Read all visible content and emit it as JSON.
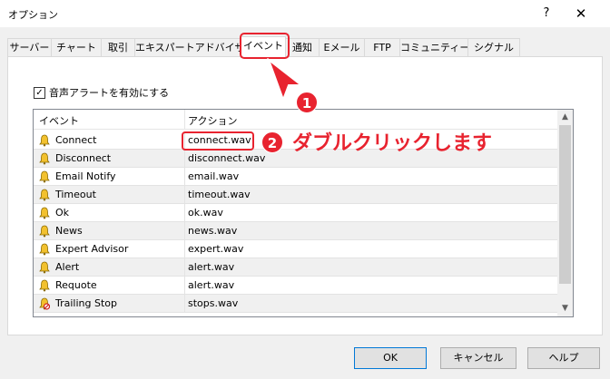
{
  "window": {
    "title": "オプション",
    "help_label": "?",
    "close_label": "✕"
  },
  "tabs": [
    {
      "label": "サーバー"
    },
    {
      "label": "チャート"
    },
    {
      "label": "取引"
    },
    {
      "label": "エキスパートアドバイザ"
    },
    {
      "label": "イベント"
    },
    {
      "label": "通知"
    },
    {
      "label": "Eメール"
    },
    {
      "label": "FTP"
    },
    {
      "label": "コミュニティー"
    },
    {
      "label": "シグナル"
    }
  ],
  "active_tab": "イベント",
  "sound_alert": {
    "label": "音声アラートを有効にする",
    "checked": true,
    "check_glyph": "✓"
  },
  "table": {
    "columns": [
      "イベント",
      "アクション"
    ],
    "rows": [
      {
        "event": "Connect",
        "action": "connect.wav",
        "icon": "bell-icon"
      },
      {
        "event": "Disconnect",
        "action": "disconnect.wav",
        "icon": "bell-icon"
      },
      {
        "event": "Email Notify",
        "action": "email.wav",
        "icon": "bell-icon"
      },
      {
        "event": "Timeout",
        "action": "timeout.wav",
        "icon": "bell-icon"
      },
      {
        "event": "Ok",
        "action": "ok.wav",
        "icon": "bell-icon"
      },
      {
        "event": "News",
        "action": "news.wav",
        "icon": "bell-icon"
      },
      {
        "event": "Expert Advisor",
        "action": "expert.wav",
        "icon": "bell-icon"
      },
      {
        "event": "Alert",
        "action": "alert.wav",
        "icon": "bell-icon"
      },
      {
        "event": "Requote",
        "action": "alert.wav",
        "icon": "bell-icon"
      },
      {
        "event": "Trailing Stop",
        "action": "stops.wav",
        "icon": "bell-disabled-icon"
      }
    ],
    "scroll_up": "▲",
    "scroll_down": "▼"
  },
  "annotations": {
    "step1": "1",
    "step2": "2",
    "step2_text": "ダブルクリックします"
  },
  "buttons": {
    "ok": "OK",
    "cancel": "キャンセル",
    "help": "ヘルプ"
  },
  "colors": {
    "annotation_red": "#e8232f",
    "bell_yellow": "#f2c12e"
  }
}
